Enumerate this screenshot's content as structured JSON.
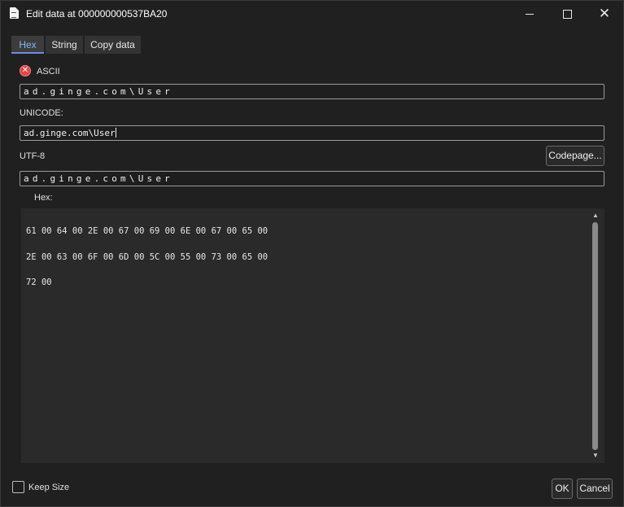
{
  "window": {
    "title": "Edit data at 000000000537BA20",
    "icons": {
      "app": "document-icon",
      "minimize": "minimize-icon",
      "maximize": "maximize-icon",
      "close": "close-icon",
      "close_glyph": "✕"
    }
  },
  "tabs": [
    {
      "label": "Hex",
      "active": true
    },
    {
      "label": "String",
      "active": false
    },
    {
      "label": "Copy data",
      "active": false
    }
  ],
  "ascii": {
    "label": "ASCII",
    "status_icon": "error-icon",
    "status_glyph": "✕",
    "value": "ad.ginge.com\\User"
  },
  "unicode": {
    "label": "UNICODE:",
    "value": "ad.ginge.com\\User"
  },
  "utf8": {
    "label": "UTF-8",
    "value": "ad.ginge.com\\User",
    "codepage_button": "Codepage..."
  },
  "hex": {
    "label": "Hex:",
    "lines": [
      "61 00 64 00 2E 00 67 00 69 00 6E 00 67 00 65 00",
      "2E 00 63 00 6F 00 6D 00 5C 00 55 00 73 00 65 00",
      "72 00"
    ],
    "scroll_up_glyph": "▲",
    "scroll_down_glyph": "▼"
  },
  "footer": {
    "keep_size_label": "Keep Size",
    "keep_size_checked": false,
    "ok_label": "OK",
    "cancel_label": "Cancel"
  },
  "colors": {
    "background": "#202020",
    "active_tab_text": "#8ab4f8",
    "error": "#e04848"
  }
}
